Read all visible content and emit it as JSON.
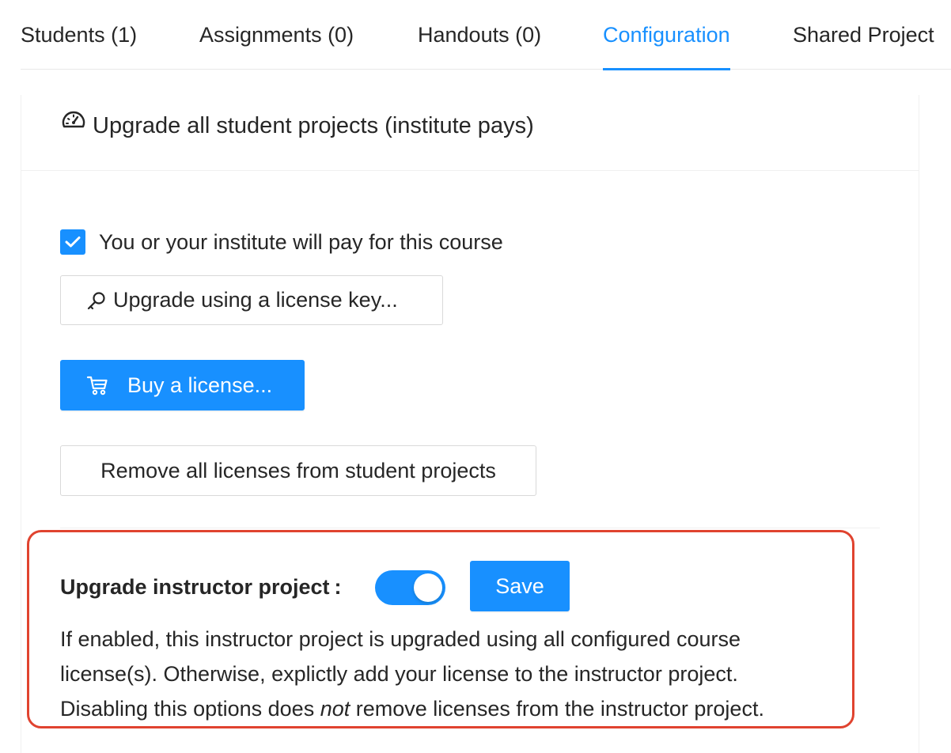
{
  "tabs": [
    {
      "label": "Students (1)",
      "active": false
    },
    {
      "label": "Assignments (0)",
      "active": false
    },
    {
      "label": "Handouts (0)",
      "active": false
    },
    {
      "label": "Configuration",
      "active": true
    },
    {
      "label": "Shared Project",
      "active": false
    }
  ],
  "card": {
    "title": "Upgrade all student projects (institute pays)",
    "title_icon": "dashboard-icon"
  },
  "pay_checkbox": {
    "label": "You or your institute will pay for this course",
    "checked": true
  },
  "buttons": {
    "license_key": {
      "label": "Upgrade using a license key...",
      "icon": "key-icon"
    },
    "buy_license": {
      "label": "Buy a license...",
      "icon": "shopping-cart-icon"
    },
    "remove_licenses": {
      "label": "Remove all licenses from student projects"
    }
  },
  "instructor": {
    "label": "Upgrade instructor project",
    "colon": ":",
    "toggle_on": true,
    "save_label": "Save",
    "desc_line1": "If enabled, this instructor project is upgraded using all configured course",
    "desc_line2": "license(s). Otherwise, explictly add your license to the instructor project.",
    "desc_line3_a": "Disabling this options does ",
    "desc_line3_em": "not",
    "desc_line3_b": " remove licenses from the instructor project."
  },
  "colors": {
    "accent": "#1890ff",
    "highlight_border": "#e0432f",
    "text": "#262626"
  }
}
